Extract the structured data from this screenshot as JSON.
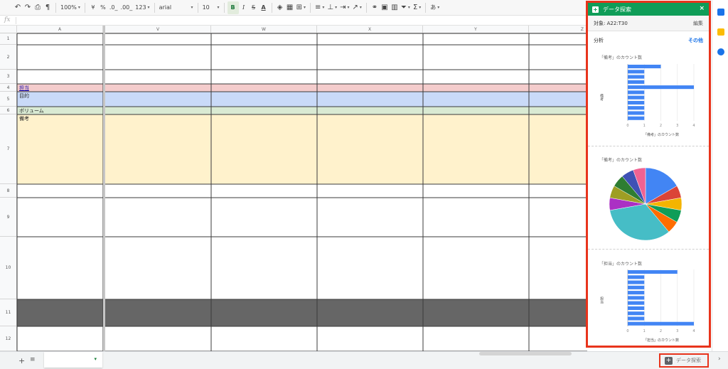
{
  "toolbar": {
    "undo_icon": "undo-icon",
    "redo_icon": "redo-icon",
    "print_icon": "print-icon",
    "paint_format_icon": "paint-format-icon",
    "zoom": "100%",
    "currency": "¥",
    "percent": "%",
    "decrease_decimal": ".0_",
    "increase_decimal": ".00_",
    "more_formats": "123",
    "font_name": "arial",
    "font_size": "10",
    "bold": "B",
    "italic": "I",
    "strike": "S",
    "text_color": "A",
    "input_tools": "あ"
  },
  "formula_bar": {
    "fx": "fx"
  },
  "columns": [
    {
      "name": "A"
    },
    {
      "name": "V"
    },
    {
      "name": "W"
    },
    {
      "name": "X"
    },
    {
      "name": "Y"
    },
    {
      "name": "Z"
    }
  ],
  "rows": [
    {
      "num": "1"
    },
    {
      "num": "2"
    },
    {
      "num": "3"
    },
    {
      "num": "4"
    },
    {
      "num": "5"
    },
    {
      "num": "6"
    },
    {
      "num": "7"
    },
    {
      "num": "8"
    },
    {
      "num": "9"
    },
    {
      "num": "10"
    },
    {
      "num": "11"
    },
    {
      "num": "12"
    }
  ],
  "cells": {
    "r4_label": "担当",
    "r5_label": "目的",
    "r6_label": "ボリューム",
    "r7_label": "備考"
  },
  "colors": {
    "row4": "#f4cccc",
    "row5": "#c9daf8",
    "row6": "#d9ead3",
    "row7": "#fff2cc",
    "row11": "#666666",
    "explore_green": "#0f9d58",
    "highlight_red": "#e8341c",
    "bar_blue": "#4285f4"
  },
  "bottom_bar": {
    "add_sheet_icon": "+",
    "all_sheets_icon": "≡",
    "sheet_caret": "▾",
    "explore_button": "データ探索",
    "explore_icon": "+"
  },
  "explore_panel": {
    "title": "データ探索",
    "close": "×",
    "range_label": "対象: A22:T30",
    "edit_label": "編集",
    "analysis_label": "分析",
    "more_label": "その他",
    "card1_title": "「備考」のカウント数",
    "card1_ylabel": "備考",
    "card1_xlabel": "「備考」のカウント数",
    "card2_title": "「備考」のカウント数",
    "card3_title": "「担当」のカウント数",
    "card3_ylabel": "担当",
    "card3_xlabel": "「担当」のカウント数"
  },
  "chart_data": [
    {
      "type": "bar",
      "orientation": "horizontal",
      "title": "「備考」のカウント数",
      "xlabel": "「備考」のカウント数",
      "ylabel": "備考",
      "xlim": [
        0,
        4
      ],
      "xticks": [
        "0",
        "1",
        "2",
        "3",
        "4"
      ],
      "values": [
        2,
        1,
        1,
        1,
        4,
        1,
        1,
        1,
        1,
        1,
        1
      ]
    },
    {
      "type": "pie",
      "title": "「備考」のカウント数",
      "values": [
        3,
        1,
        1,
        1,
        1,
        6,
        1,
        1,
        1,
        1,
        1
      ],
      "colors": [
        "#4285f4",
        "#db4437",
        "#f4b400",
        "#0f9d58",
        "#ff6d00",
        "#46bdc6",
        "#ab30c4",
        "#9e9e24",
        "#2e7d32",
        "#3f51b5",
        "#f06292"
      ]
    },
    {
      "type": "bar",
      "orientation": "horizontal",
      "title": "「担当」のカウント数",
      "xlabel": "「担当」のカウント数",
      "ylabel": "担当",
      "xlim": [
        0,
        4
      ],
      "xticks": [
        "0",
        "1",
        "2",
        "3",
        "4"
      ],
      "values": [
        3,
        1,
        1,
        1,
        1,
        1,
        1,
        1,
        1,
        1,
        4
      ]
    }
  ]
}
